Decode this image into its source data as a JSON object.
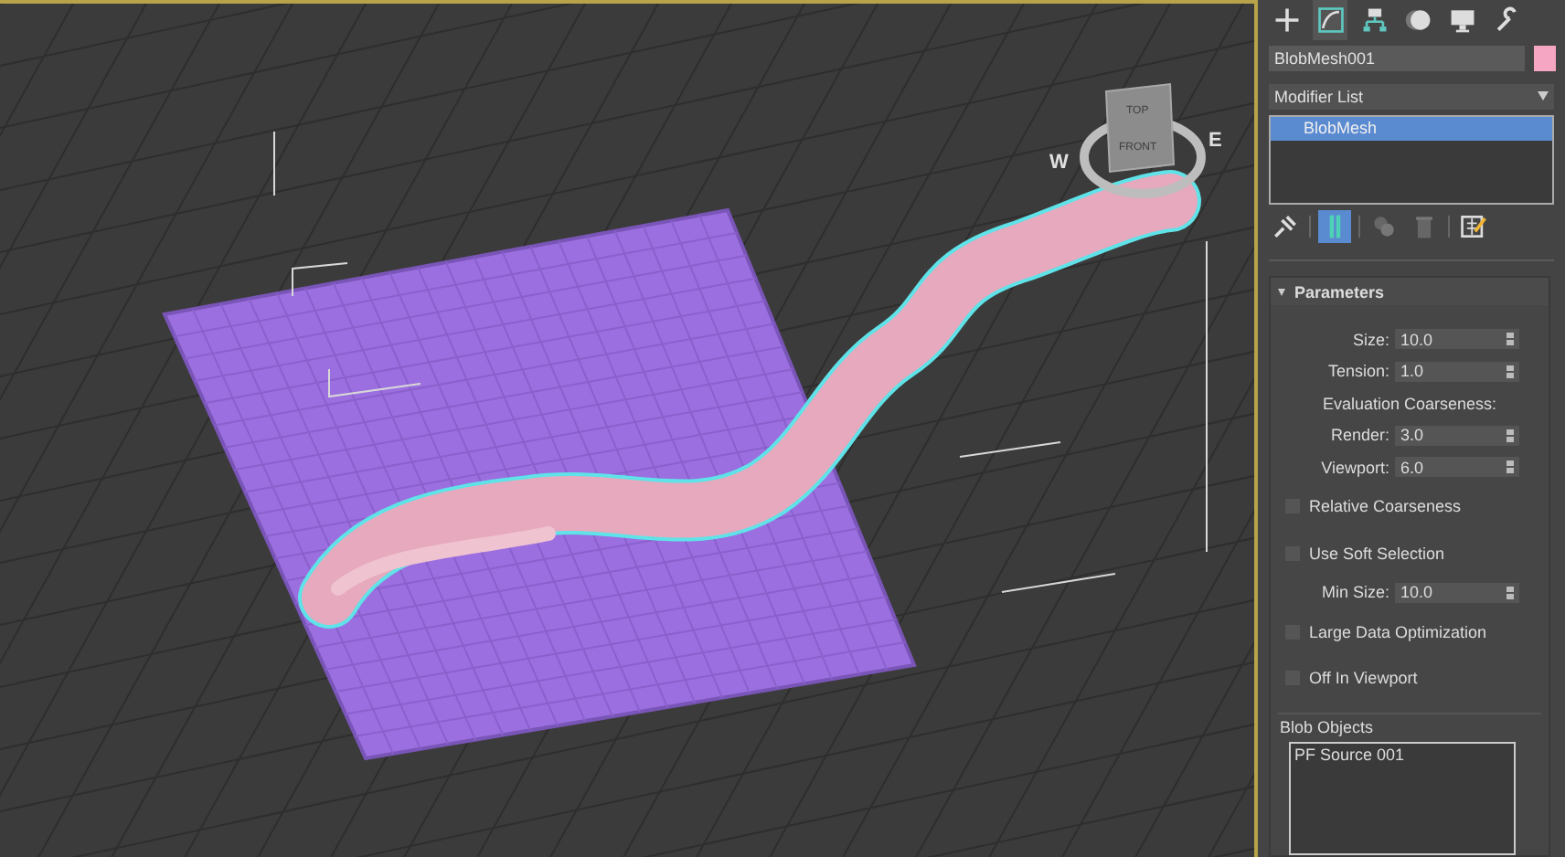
{
  "viewport": {
    "viewcube": {
      "top": "TOP",
      "front": "FRONT",
      "west": "W",
      "east": "E"
    }
  },
  "command_tabs": [
    {
      "selected": false
    },
    {
      "selected": true
    },
    {
      "selected": false
    },
    {
      "selected": false
    },
    {
      "selected": false
    },
    {
      "selected": false
    }
  ],
  "object_name": "BlobMesh001",
  "modifier_list": {
    "label": "Modifier List"
  },
  "modifier_stack": [
    {
      "label": "BlobMesh",
      "selected": true
    }
  ],
  "stack_tools": [
    {
      "active": false
    },
    {
      "active": true
    },
    {
      "active": false
    },
    {
      "active": false
    },
    {
      "active": false
    }
  ],
  "rollout": {
    "title": "Parameters",
    "expanded": true
  },
  "parameters": [
    {
      "kind": "spinner",
      "label": "Size:",
      "value": "10.0"
    },
    {
      "kind": "spinner",
      "label": "Tension:",
      "value": "1.0"
    },
    {
      "kind": "label",
      "label": "Evaluation Coarseness:"
    },
    {
      "kind": "spinner",
      "label": "Render:",
      "value": "3.0"
    },
    {
      "kind": "spinner",
      "label": "Viewport:",
      "value": "6.0"
    },
    {
      "kind": "checkbox",
      "label": "Relative Coarseness",
      "checked": false
    },
    {
      "kind": "checkbox",
      "label": "Use Soft Selection",
      "checked": false
    },
    {
      "kind": "spinner",
      "label": "Min Size:",
      "value": "10.0"
    },
    {
      "kind": "checkbox",
      "label": "Large Data Optimization",
      "checked": false
    },
    {
      "kind": "checkbox",
      "label": "Off In Viewport",
      "checked": false
    }
  ],
  "blob_objects": {
    "title": "Blob Objects",
    "items": [
      {
        "label": "PF Source 001",
        "selected": false
      }
    ]
  }
}
